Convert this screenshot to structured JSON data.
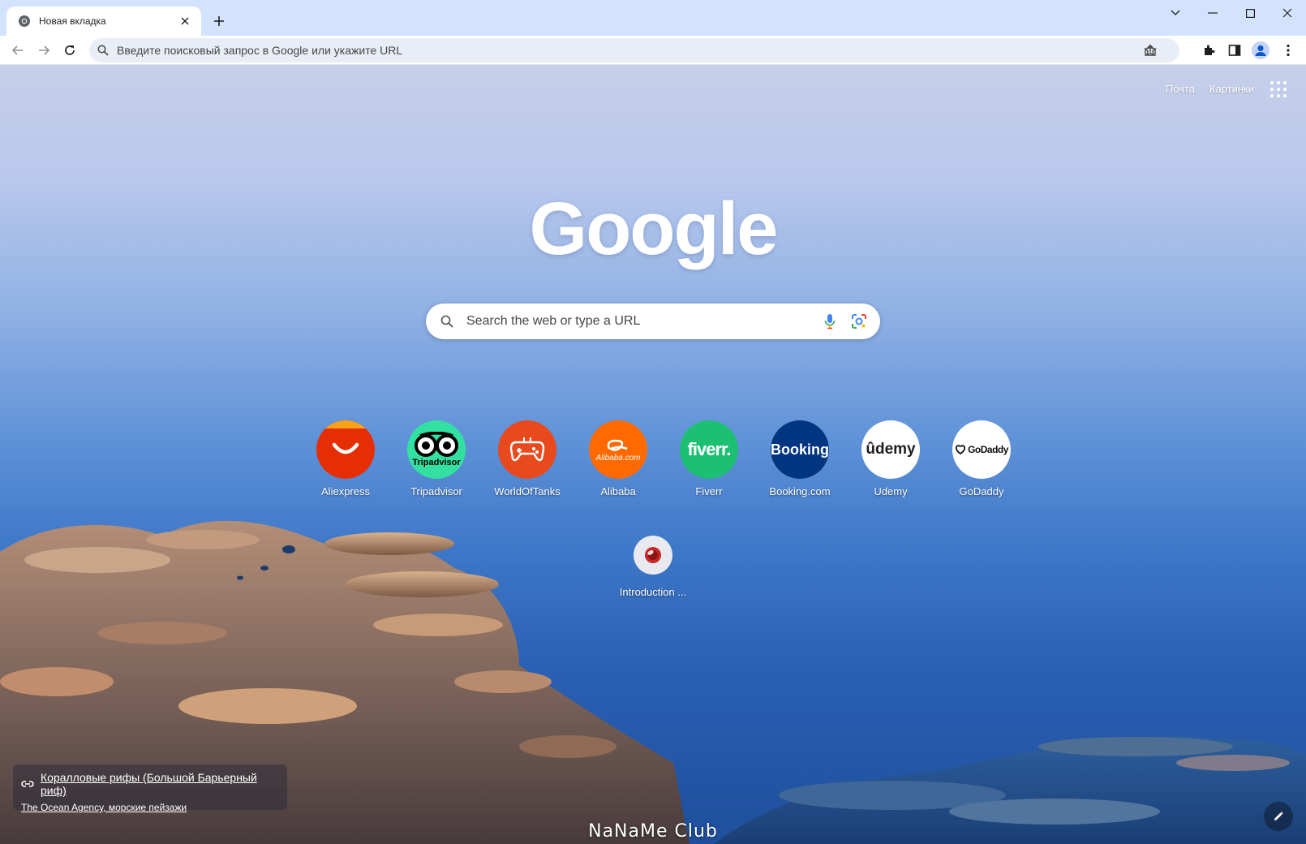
{
  "tab": {
    "title": "Новая вкладка"
  },
  "omnibox": {
    "placeholder": "Введите поисковый запрос в Google или укажите URL"
  },
  "toplinks": {
    "mail": "Почта",
    "images": "Картинки"
  },
  "logo": {
    "text": "Google"
  },
  "search": {
    "placeholder": "Search the web or type a URL"
  },
  "shortcuts": [
    {
      "label": "Aliexpress",
      "icon": "aliexpress-icon",
      "color": "#e62e04"
    },
    {
      "label": "Tripadvisor",
      "icon": "tripadvisor-icon",
      "color": "#34e0a1",
      "badge": "Tripadvisor"
    },
    {
      "label": "WorldOfTanks",
      "icon": "worldoftanks-icon",
      "color": "#e8491d"
    },
    {
      "label": "Alibaba",
      "icon": "alibaba-icon",
      "color": "#ff6a00",
      "badge": "Alibaba.com"
    },
    {
      "label": "Fiverr",
      "icon": "fiverr-icon",
      "color": "#1dbf73",
      "badge": "fiverr."
    },
    {
      "label": "Booking.com",
      "icon": "booking-icon",
      "color": "#003580",
      "badge": "Booking"
    },
    {
      "label": "Udemy",
      "icon": "udemy-icon",
      "color": "#ffffff",
      "badge": "ûdemy"
    },
    {
      "label": "GoDaddy",
      "icon": "godaddy-icon",
      "color": "#ffffff",
      "badge": "GoDaddy"
    }
  ],
  "shortcut_extra": {
    "label": "Introduction ...",
    "icon": "introduction-icon"
  },
  "attribution": {
    "title": "Коралловые рифы (Большой Барьерный риф)",
    "author": "The Ocean Agency, морские пейзажи"
  },
  "watermark": "NaNaMe Club"
}
